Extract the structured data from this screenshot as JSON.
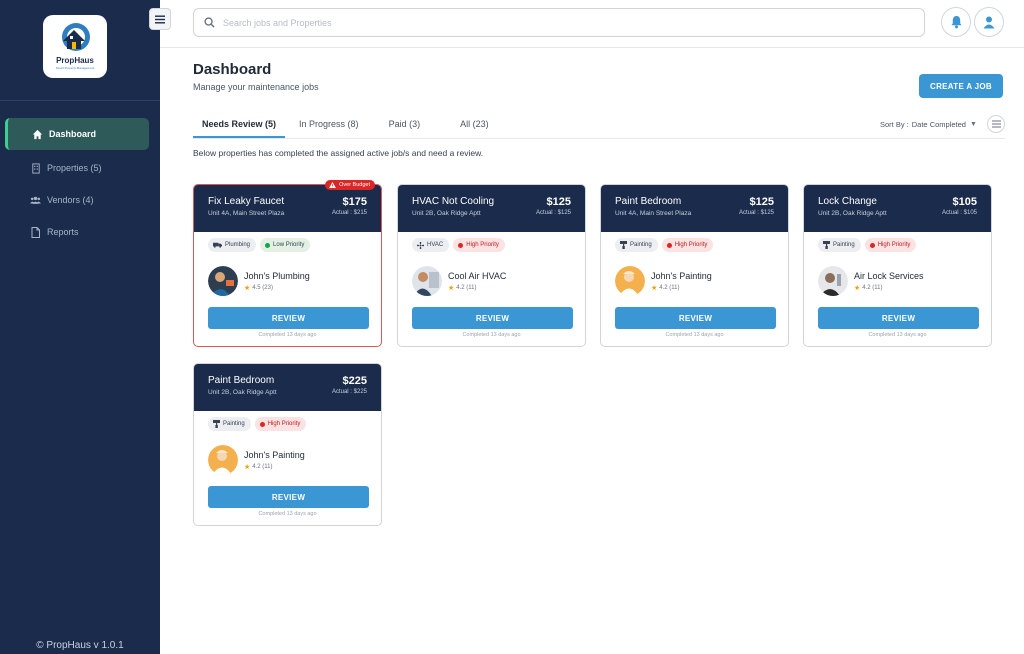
{
  "app": {
    "name": "PropHaus",
    "tagline": "Smart Property Management",
    "footer": "© PropHaus v 1.0.1"
  },
  "sidebar": {
    "items": [
      {
        "label": "Dashboard",
        "icon": "home-icon",
        "active": true
      },
      {
        "label": "Properties (5)",
        "icon": "building-icon",
        "active": false
      },
      {
        "label": "Vendors (4)",
        "icon": "users-icon",
        "active": false
      },
      {
        "label": "Reports",
        "icon": "document-icon",
        "active": false
      }
    ]
  },
  "search": {
    "placeholder": "Search jobs and Properties"
  },
  "header": {
    "title": "Dashboard",
    "subtitle": "Manage your maintenance jobs",
    "create_label": "CREATE A JOB"
  },
  "tabs": [
    {
      "label": "Needs Review (5)",
      "active": true
    },
    {
      "label": "In Progress (8)",
      "active": false
    },
    {
      "label": "Paid (3)",
      "active": false
    },
    {
      "label": "All (23)",
      "active": false
    }
  ],
  "sort": {
    "label": "Sort By :",
    "value": "Date Completed"
  },
  "info_text": "Below properties has completed the assigned active job/s and need a review.",
  "colors": {
    "navy": "#1b2b4b",
    "accent": "#3b97d3",
    "alert": "#d92626",
    "active_bar": "#3ecf8e"
  },
  "jobs": [
    {
      "title": "Fix Leaky Faucet",
      "unit": "Unit 4A, Main Street Plaza",
      "price": "$175",
      "actual": "Actual : $215",
      "over_budget": "Over Budget",
      "category": "Plumbing",
      "category_icon": "truck-icon",
      "priority": "Low Priority",
      "priority_level": "low",
      "vendor": "John's Plumbing",
      "rating": "4.5 (23)",
      "review_label": "REVIEW",
      "completed": "Completed 13 days ago"
    },
    {
      "title": "HVAC Not Cooling",
      "unit": "Unit 2B, Oak Ridge Aptt",
      "price": "$125",
      "actual": "Actual : $125",
      "over_budget": "",
      "category": "HVAC",
      "category_icon": "fan-icon",
      "priority": "High Priority",
      "priority_level": "high",
      "vendor": "Cool Air HVAC",
      "rating": "4.2 (11)",
      "review_label": "REVIEW",
      "completed": "Completed 13 days ago"
    },
    {
      "title": "Paint Bedroom",
      "unit": "Unit 4A, Main Street Plaza",
      "price": "$125",
      "actual": "Actual : $125",
      "over_budget": "",
      "category": "Painting",
      "category_icon": "paint-roller-icon",
      "priority": "High Priority",
      "priority_level": "high",
      "vendor": "John's Painting",
      "rating": "4.2 (11)",
      "review_label": "REVIEW",
      "completed": "Completed 13 days ago"
    },
    {
      "title": "Lock Change",
      "unit": "Unit 2B, Oak Ridge Aptt",
      "price": "$105",
      "actual": "Actual : $105",
      "over_budget": "",
      "category": "Painting",
      "category_icon": "paint-roller-icon",
      "priority": "High Priority",
      "priority_level": "high",
      "vendor": "Air Lock Services",
      "rating": "4.2 (11)",
      "review_label": "REVIEW",
      "completed": "Completed 13 days ago"
    },
    {
      "title": "Paint Bedroom",
      "unit": "Unit 2B, Oak Ridge Aptt",
      "price": "$225",
      "actual": "Actual : $225",
      "over_budget": "",
      "category": "Painting",
      "category_icon": "paint-roller-icon",
      "priority": "High Priority",
      "priority_level": "high",
      "vendor": "John's Painting",
      "rating": "4.2 (11)",
      "review_label": "REVIEW",
      "completed": "Completed 13 days ago"
    }
  ]
}
